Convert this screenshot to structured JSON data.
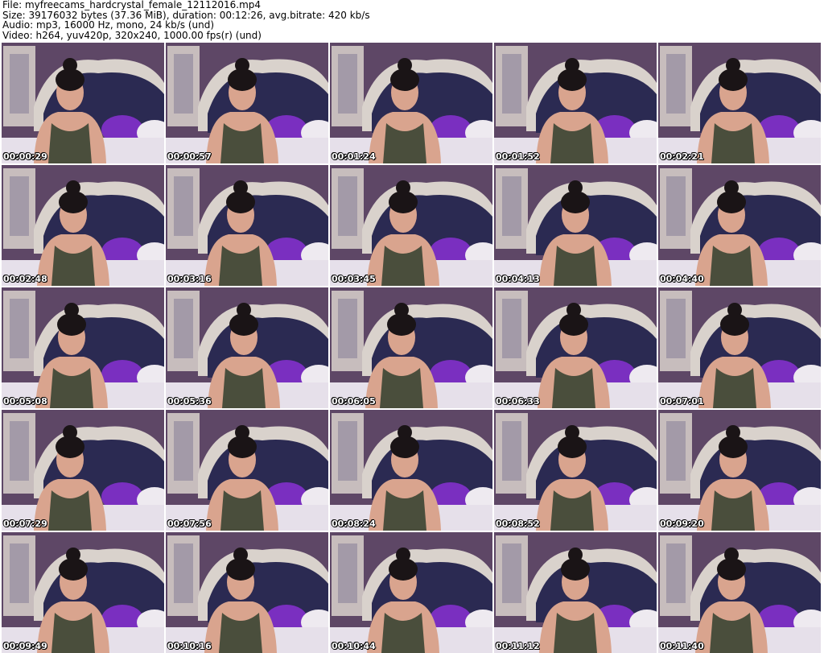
{
  "info": {
    "file": "File: myfreecams_hardcrystal_female_12112016.mp4",
    "size": "Size: 39176032 bytes (37.36 MiB), duration: 00:12:26, avg.bitrate: 420 kb/s",
    "audio": "Audio: mp3, 16000 Hz, mono, 24 kb/s (und)",
    "video": "Video: h264, yuv420p, 320x240, 1000.00 fps(r) (und)"
  },
  "frames": [
    "00:00:29",
    "00:00:57",
    "00:01:24",
    "00:01:52",
    "00:02:21",
    "00:02:48",
    "00:03:16",
    "00:03:45",
    "00:04:13",
    "00:04:40",
    "00:05:08",
    "00:05:36",
    "00:06:05",
    "00:06:33",
    "00:07:01",
    "00:07:29",
    "00:07:56",
    "00:08:24",
    "00:08:52",
    "00:09:20",
    "00:09:49",
    "00:10:16",
    "00:10:44",
    "00:11:12",
    "00:11:40"
  ],
  "colors": {
    "wall": "#5e4766",
    "headboard": "#2b2a52",
    "frame": "#d9d2cc",
    "pillow": "#7a2fc0",
    "sheet": "#e6e0ea",
    "skin": "#d9a48e",
    "top": "#4a4e3c",
    "hair": "#1a1416"
  }
}
